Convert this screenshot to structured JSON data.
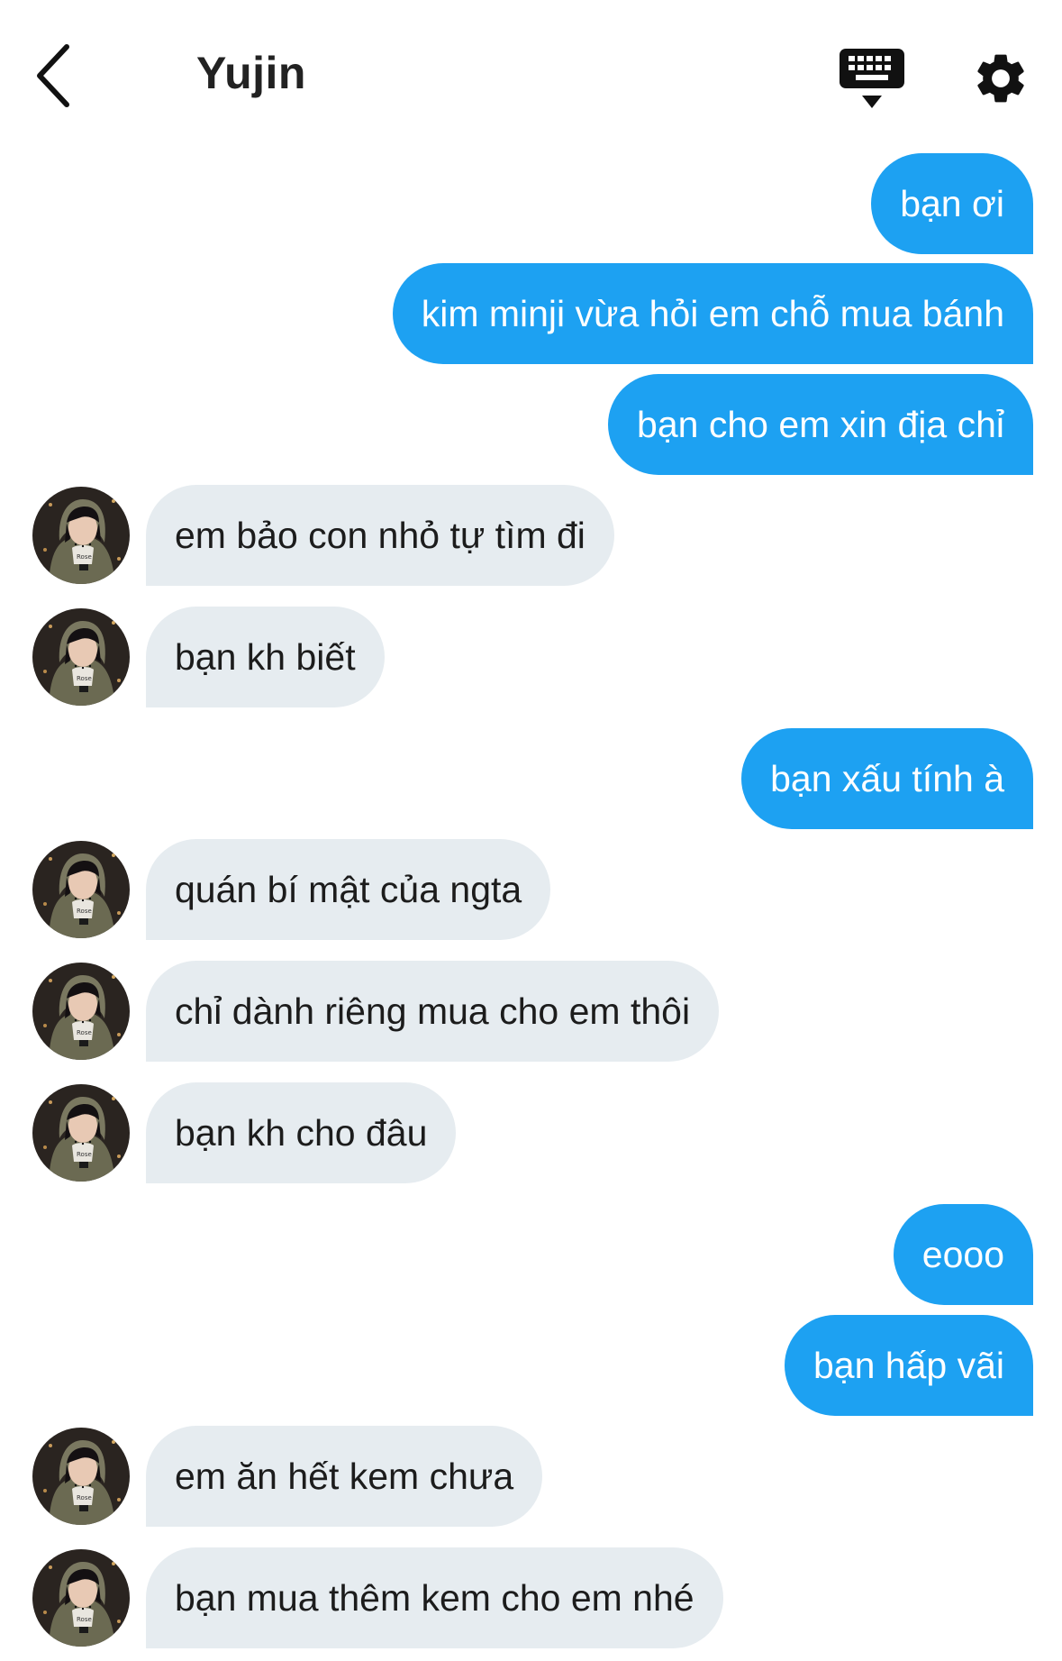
{
  "header": {
    "title": "Yujin",
    "back_icon": "chevron-left-icon",
    "keyboard_icon": "keyboard-icon",
    "settings_icon": "gear-icon"
  },
  "colors": {
    "outgoing_bubble": "#1da1f2",
    "incoming_bubble": "#e6ecf0",
    "title": "#222222"
  },
  "messages": [
    {
      "direction": "out",
      "text": "bạn ơi"
    },
    {
      "direction": "out",
      "text": "kim minji vừa hỏi em chỗ mua bánh"
    },
    {
      "direction": "out",
      "text": "bạn cho em xin địa chỉ"
    },
    {
      "direction": "in",
      "text": "em bảo con nhỏ tự tìm đi"
    },
    {
      "direction": "in",
      "text": "bạn kh biết"
    },
    {
      "direction": "out",
      "text": "bạn xấu tính à"
    },
    {
      "direction": "in",
      "text": "quán bí mật của ngta"
    },
    {
      "direction": "in",
      "text": "chỉ dành riêng mua cho em thôi"
    },
    {
      "direction": "in",
      "text": "bạn kh cho đâu"
    },
    {
      "direction": "out",
      "text": "eooo"
    },
    {
      "direction": "out",
      "text": "bạn hấp vãi"
    },
    {
      "direction": "in",
      "text": "em ăn hết kem chưa"
    },
    {
      "direction": "in",
      "text": "bạn mua thêm kem cho em nhé"
    }
  ]
}
